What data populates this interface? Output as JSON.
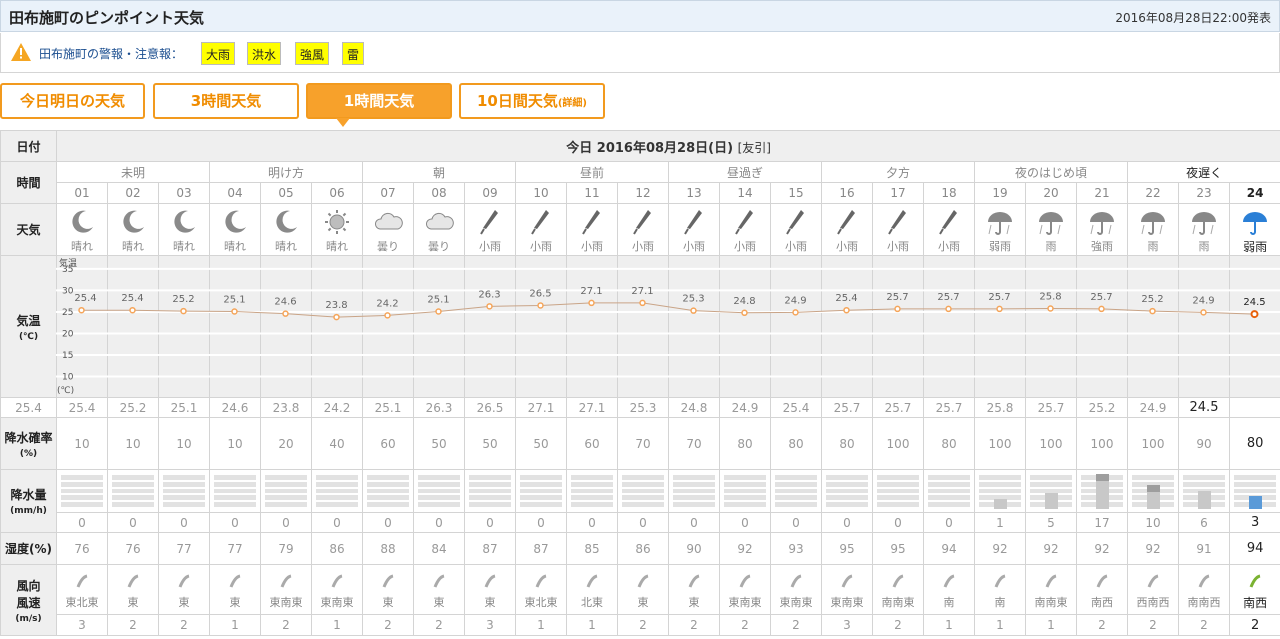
{
  "header": {
    "title": "田布施町のピンポイント天気",
    "issued": "2016年08月28日22:00発表"
  },
  "warnings": {
    "label": "田布施町の警報・注意報：",
    "items": [
      "大雨",
      "洪水",
      "強風",
      "雷"
    ],
    "icon": "warning-icon"
  },
  "tabs": [
    {
      "label": "今日明日の天気",
      "active": false
    },
    {
      "label": "3時間天気",
      "active": false
    },
    {
      "label": "1時間天気",
      "active": true
    },
    {
      "label": "10日間天気",
      "extra": "(詳細)",
      "active": false
    }
  ],
  "labels": {
    "date": "日付",
    "time": "時間",
    "weather": "天気",
    "temp": "気温",
    "temp_unit": "(℃)",
    "precip_prob": "降水確率",
    "precip_prob_unit": "(%)",
    "precip_amt": "降水量",
    "precip_amt_unit": "(mm/h)",
    "humidity": "湿度(%)",
    "wind_dir": "風向",
    "wind_speed": "風速",
    "wind_unit": "(m/s)"
  },
  "date": {
    "text": "今日 2016年08月28日(日)",
    "note": "[友引]"
  },
  "periods": [
    {
      "label": "未明",
      "span": 3
    },
    {
      "label": "明け方",
      "span": 3
    },
    {
      "label": "朝",
      "span": 3
    },
    {
      "label": "昼前",
      "span": 3
    },
    {
      "label": "昼過ぎ",
      "span": 3
    },
    {
      "label": "夕方",
      "span": 3
    },
    {
      "label": "夜のはじめ頃",
      "span": 3
    },
    {
      "label": "夜遅く",
      "span": 3
    }
  ],
  "hours": [
    "01",
    "02",
    "03",
    "04",
    "05",
    "06",
    "07",
    "08",
    "09",
    "10",
    "11",
    "12",
    "13",
    "14",
    "15",
    "16",
    "17",
    "18",
    "19",
    "20",
    "21",
    "22",
    "23",
    "24"
  ],
  "weather": [
    "晴れ",
    "晴れ",
    "晴れ",
    "晴れ",
    "晴れ",
    "晴れ",
    "曇り",
    "曇り",
    "小雨",
    "小雨",
    "小雨",
    "小雨",
    "小雨",
    "小雨",
    "小雨",
    "小雨",
    "小雨",
    "小雨",
    "弱雨",
    "雨",
    "強雨",
    "雨",
    "雨",
    "弱雨"
  ],
  "weather_icons": [
    "moon-icon",
    "moon-icon",
    "moon-icon",
    "moon-icon",
    "moon-icon",
    "sun-icon",
    "cloud-icon",
    "cloud-icon",
    "umbrella-closed-icon",
    "umbrella-closed-icon",
    "umbrella-closed-icon",
    "umbrella-closed-icon",
    "umbrella-closed-icon",
    "umbrella-closed-icon",
    "umbrella-closed-icon",
    "umbrella-closed-icon",
    "umbrella-closed-icon",
    "umbrella-closed-icon",
    "umbrella-open-icon",
    "umbrella-open-icon",
    "umbrella-open-icon",
    "umbrella-open-icon",
    "umbrella-open-icon",
    "umbrella-open-icon"
  ],
  "temps": [
    "25.4",
    "25.4",
    "25.2",
    "25.1",
    "24.6",
    "23.8",
    "24.2",
    "25.1",
    "26.3",
    "26.5",
    "27.1",
    "27.1",
    "25.3",
    "24.8",
    "24.9",
    "25.4",
    "25.7",
    "25.7",
    "25.7",
    "25.8",
    "25.7",
    "25.2",
    "24.9",
    "24.5"
  ],
  "precip_prob": [
    "10",
    "10",
    "10",
    "10",
    "20",
    "40",
    "60",
    "50",
    "50",
    "50",
    "60",
    "70",
    "70",
    "80",
    "80",
    "80",
    "100",
    "80",
    "100",
    "100",
    "100",
    "100",
    "90",
    "80"
  ],
  "precip_amt": [
    "0",
    "0",
    "0",
    "0",
    "0",
    "0",
    "0",
    "0",
    "0",
    "0",
    "0",
    "0",
    "0",
    "0",
    "0",
    "0",
    "0",
    "0",
    "1",
    "5",
    "17",
    "10",
    "6",
    "3"
  ],
  "humidity": [
    "76",
    "76",
    "77",
    "77",
    "79",
    "86",
    "88",
    "84",
    "87",
    "87",
    "85",
    "86",
    "90",
    "92",
    "93",
    "95",
    "95",
    "94",
    "92",
    "92",
    "92",
    "92",
    "91",
    "94"
  ],
  "wind_dir": [
    "東北東",
    "東",
    "東",
    "東",
    "東南東",
    "東南東",
    "東",
    "東",
    "東",
    "東北東",
    "北東",
    "東",
    "東",
    "東南東",
    "東南東",
    "東南東",
    "南南東",
    "南",
    "南",
    "南南東",
    "南西",
    "西南西",
    "南南西",
    "南西"
  ],
  "wind_speed": [
    "3",
    "2",
    "2",
    "1",
    "2",
    "1",
    "2",
    "2",
    "3",
    "1",
    "1",
    "2",
    "2",
    "2",
    "2",
    "3",
    "2",
    "1",
    "1",
    "1",
    "2",
    "2",
    "2",
    "2"
  ],
  "chart_data": {
    "type": "line",
    "x": [
      "01",
      "02",
      "03",
      "04",
      "05",
      "06",
      "07",
      "08",
      "09",
      "10",
      "11",
      "12",
      "13",
      "14",
      "15",
      "16",
      "17",
      "18",
      "19",
      "20",
      "21",
      "22",
      "23",
      "24"
    ],
    "series": [
      {
        "values": [
          25.4,
          25.4,
          25.2,
          25.1,
          24.6,
          23.8,
          24.2,
          25.1,
          26.3,
          26.5,
          27.1,
          27.1,
          25.3,
          24.8,
          24.9,
          25.4,
          25.7,
          25.7,
          25.7,
          25.8,
          25.7,
          25.2,
          24.9,
          24.5
        ]
      }
    ],
    "ylabel": "気温",
    "yunit": "(℃)",
    "yticks": [
      35,
      30,
      25,
      20,
      15,
      10
    ],
    "ylim": [
      5,
      38
    ],
    "grid": true,
    "line_color": "#f5a55a",
    "current_marker_color": "#e8600a"
  },
  "colors": {
    "accent": "#f7a12b",
    "warning": "#ffff00",
    "rain_bar_current": "#5a9ad8"
  }
}
